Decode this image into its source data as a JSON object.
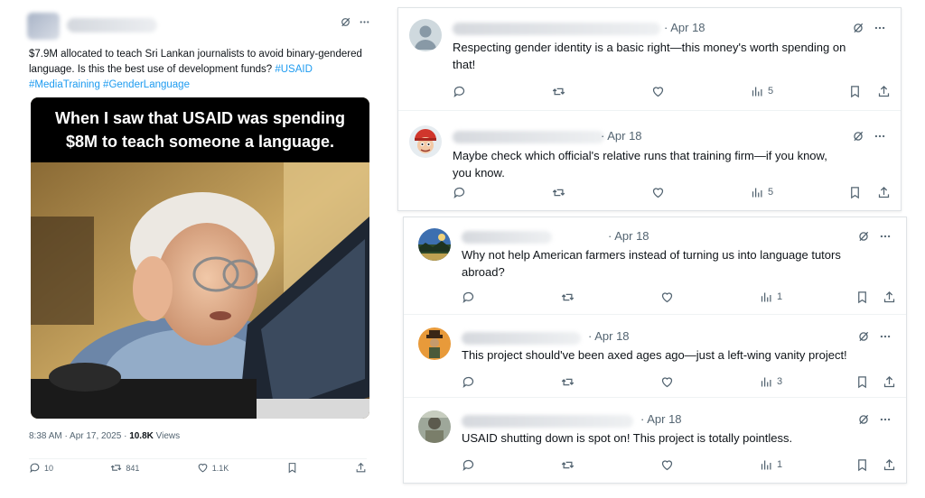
{
  "main_tweet": {
    "text": "$7.9M allocated to teach Sri Lankan journalists to avoid binary-gendered language. Is this the best use of development funds?",
    "hashtags": [
      "#USAID",
      "#MediaTraining",
      "#GenderLanguage"
    ],
    "meme_caption_line1": "When I saw that USAID was spending",
    "meme_caption_line2": "$8M to teach someone a language.",
    "timestamp": "8:38 AM · Apr 17, 2025 · ",
    "views_count": "10.8K",
    "views_label": " Views",
    "replies": "10",
    "reposts": "841",
    "likes": "1.1K"
  },
  "replies": [
    {
      "date": "· Apr 18",
      "text_line1": "Respecting gender identity is a basic right—this money's worth spending on",
      "text_line2": "that!",
      "views": "5",
      "avatar": "default-person-icon"
    },
    {
      "date": "· Apr 18",
      "text_line1": "Maybe check which official's relative runs that training firm—if you know,",
      "text_line2": "you know.",
      "views": "5",
      "avatar": "red-cartoon-avatar"
    },
    {
      "date": "· Apr 18",
      "text_line1": "Why not help American farmers instead of turning us into language tutors",
      "text_line2": "abroad?",
      "views": "1",
      "avatar": "landscape-avatar"
    },
    {
      "date": "· Apr 18",
      "text_line1": "This project should've been axed ages ago—just a left-wing vanity project!",
      "text_line2": "",
      "views": "3",
      "avatar": "cowboy-avatar"
    },
    {
      "date": "· Apr 18",
      "text_line1": "USAID shutting down is spot on! This project is totally pointless.",
      "text_line2": "",
      "views": "1",
      "avatar": "photo-avatar"
    }
  ],
  "colors": {
    "link": "#1d9bf0",
    "muted": "#536471",
    "text": "#0f1419"
  }
}
